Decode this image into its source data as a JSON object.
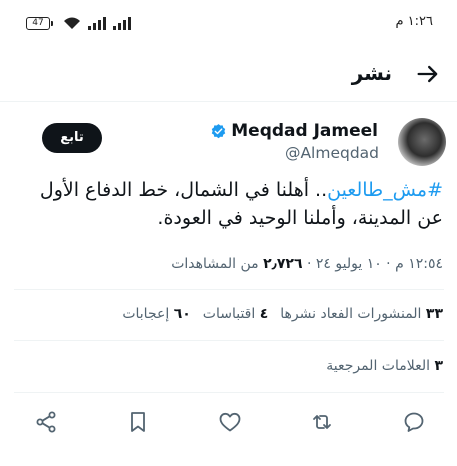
{
  "status_bar": {
    "time": "١:٢٦ م",
    "battery": "47"
  },
  "header": {
    "title": "نشر"
  },
  "tweet": {
    "author_name": "Meqdad Jameel",
    "author_handle": "@Almeqdad",
    "follow_label": "تابع",
    "hashtag": "#مش_طالعين",
    "text_rest": ".. أهلنا في الشمال، خط الدفاع الأول عن المدينة، وأملنا الوحيد في العودة.",
    "timestamp": "١٢:٥٤ م · ١٠ يوليو ٢٤ · ",
    "views_count": "٢٫٧٢٦",
    "views_label": " من المشاهدات"
  },
  "engagement": {
    "reposts_count": "٣٣",
    "reposts_label": "المنشورات الفعاد نشرها",
    "quotes_count": "٤",
    "quotes_label": "اقتباسات",
    "likes_count": "٦٠",
    "likes_label": "إعجابات"
  },
  "bookmarks": {
    "count": "٣",
    "label": "العلامات المرجعية"
  },
  "icons": {
    "back": "arrow-right-icon",
    "verified": "verified-badge-icon",
    "share": "share-icon",
    "bookmark": "bookmark-icon",
    "like": "heart-icon",
    "repost": "repost-icon",
    "reply": "reply-icon"
  },
  "colors": {
    "accent": "#1d9bf0",
    "text": "#0f1419",
    "secondary": "#536471"
  }
}
